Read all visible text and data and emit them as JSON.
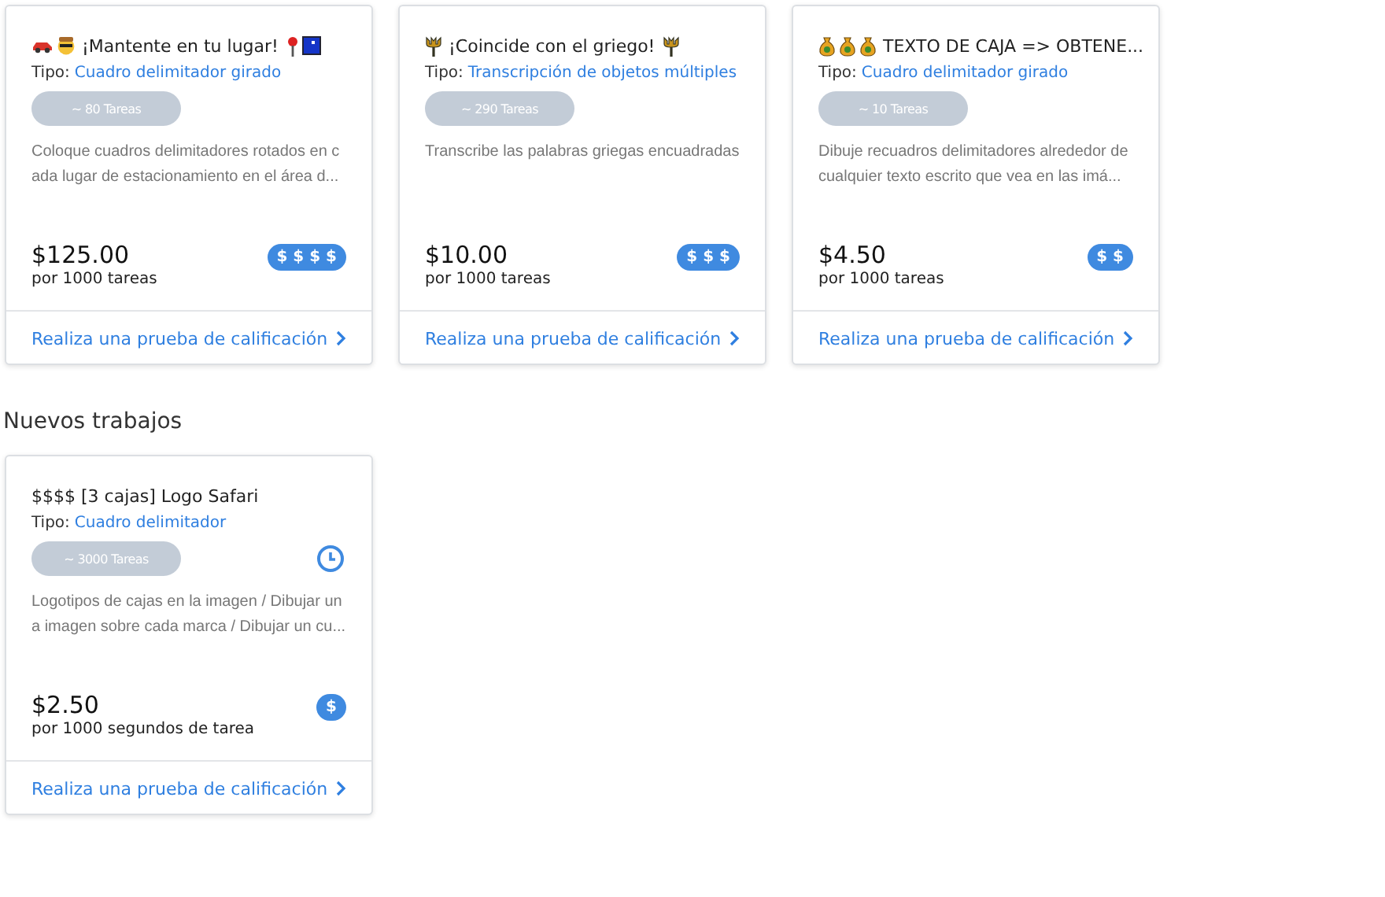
{
  "sections": [
    {
      "cards": [
        {
          "title": {
            "icons_before": [
              {
                "kind": "car"
              },
              {
                "kind": "face"
              }
            ],
            "text": "¡Mantente en tu lugar!",
            "icons_after": [
              {
                "kind": "pin"
              },
              {
                "kind": "square"
              }
            ]
          },
          "type_label": "Tipo:",
          "type": "Cuadro delimitador girado",
          "tasks": "~ 80 Tareas",
          "timed": false,
          "description": "Coloque cuadros delimitadores rotados en cada lugar de estacionamiento en el área d...",
          "price": "$125.00",
          "price_unit": "por 1000 tareas",
          "pay_badge": "$ $ $ $",
          "link": "Realiza una prueba de calificación"
        },
        {
          "title": {
            "icons_before": [
              {
                "kind": "trident"
              }
            ],
            "text": "¡Coincide con el griego!",
            "icons_after": [
              {
                "kind": "trident"
              }
            ]
          },
          "type_label": "Tipo:",
          "type": "Transcripción de objetos múltiples",
          "tasks": "~ 290 Tareas",
          "timed": false,
          "description": "Transcribe las palabras griegas encuadradas",
          "price": "$10.00",
          "price_unit": "por 1000 tareas",
          "pay_badge": "$ $ $",
          "link": "Realiza una prueba de calificación"
        },
        {
          "title": {
            "icons_before": [
              {
                "kind": "moneybag"
              },
              {
                "kind": "moneybag"
              },
              {
                "kind": "moneybag"
              }
            ],
            "text": "TEXTO DE CAJA => OBTENE..."
          },
          "type_label": "Tipo:",
          "type": "Cuadro delimitador girado",
          "tasks": "~ 10 Tareas",
          "timed": false,
          "description": "Dibuje recuadros delimitadores alrededor de cualquier texto escrito que vea en las imá...",
          "price": "$4.50",
          "price_unit": "por 1000 tareas",
          "pay_badge": "$ $",
          "link": "Realiza una prueba de calificación"
        }
      ]
    },
    {
      "heading": "Nuevos trabajos",
      "cards": [
        {
          "title": {
            "text": "$$$$ [3 cajas] Logo Safari"
          },
          "type_label": "Tipo:",
          "type": "Cuadro delimitador",
          "tasks": "~ 3000 Tareas",
          "timed": true,
          "description": "Logotipos de cajas en la imagen / Dibujar una imagen sobre cada marca / Dibujar un cu...",
          "price": "$2.50",
          "price_unit": "por 1000 segundos de tarea",
          "pay_badge": "$",
          "link": "Realiza una prueba de calificación"
        }
      ]
    }
  ]
}
